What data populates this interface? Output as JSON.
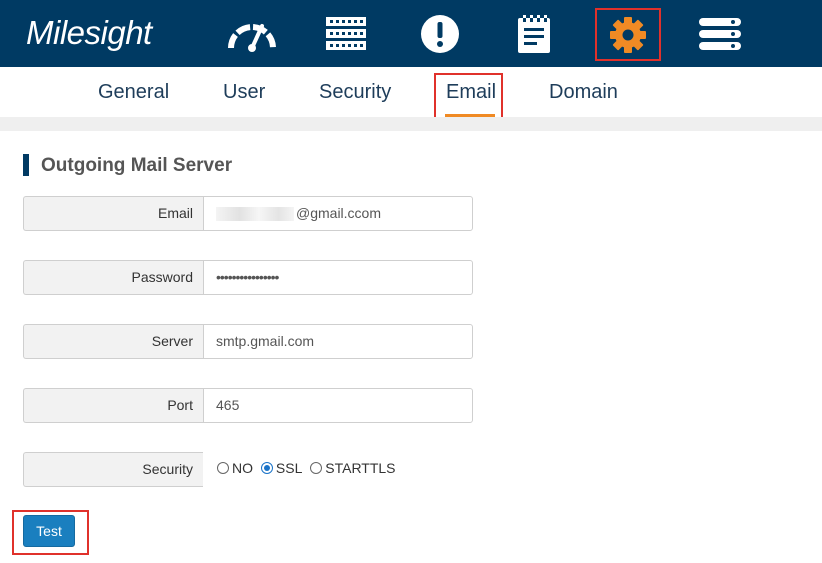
{
  "header": {
    "logo": "Milesight",
    "nav_icons": [
      "dashboard-icon",
      "server-icon",
      "alert-icon",
      "notepad-icon",
      "settings-icon",
      "menu-list-icon"
    ],
    "active_icon": "settings-icon",
    "highlight_color": "#e0312b",
    "bar_color": "#003a63",
    "accent_color": "#f08a24"
  },
  "tabs": [
    {
      "label": "General"
    },
    {
      "label": "User"
    },
    {
      "label": "Security"
    },
    {
      "label": "Email",
      "active": true
    },
    {
      "label": "Domain"
    }
  ],
  "section": {
    "title": "Outgoing Mail Server"
  },
  "form": {
    "email": {
      "label": "Email",
      "value": "@gmail.ccom"
    },
    "password": {
      "label": "Password",
      "value": "••••••••••••••••"
    },
    "server": {
      "label": "Server",
      "value": "smtp.gmail.com"
    },
    "port": {
      "label": "Port",
      "value": "465"
    },
    "security": {
      "label": "Security",
      "options": [
        "NO",
        "SSL",
        "STARTTLS"
      ],
      "selected": "SSL"
    }
  },
  "actions": {
    "test_label": "Test"
  }
}
